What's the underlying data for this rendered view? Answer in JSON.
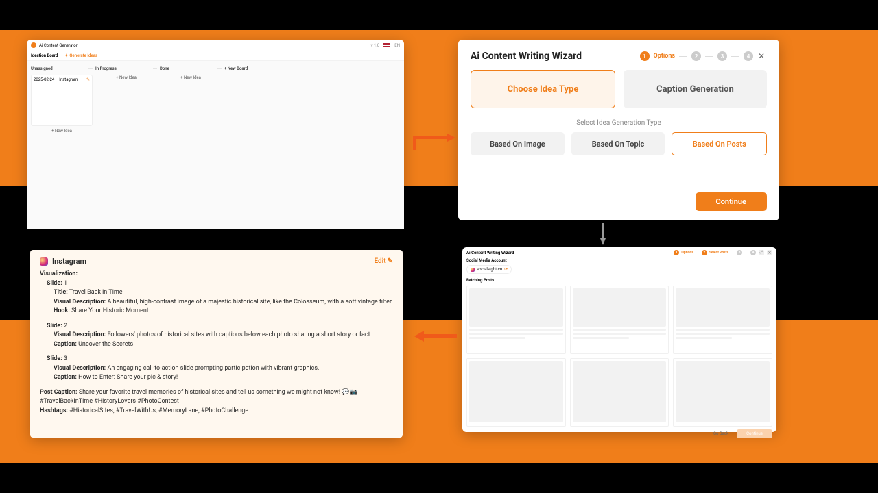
{
  "panelA": {
    "app_title": "Ai Content Generator",
    "version": "v 1.0",
    "lang": "EN",
    "board_title": "Ideation Board",
    "generate_label": "Generate Ideas",
    "columns": {
      "unassigned": {
        "title": "Unassigned",
        "card_title": "2025-02-24 – Instagram",
        "new_idea": "+ New Idea"
      },
      "in_progress": {
        "title": "In Progress",
        "new_idea": "+ New Idea"
      },
      "done": {
        "title": "Done",
        "new_idea": "+ New Idea"
      },
      "new_board": {
        "label": "+ New Board"
      }
    }
  },
  "panelB": {
    "title": "Ai Content Writing Wizard",
    "step_label": "Options",
    "tab_choose": "Choose Idea Type",
    "tab_caption": "Caption Generation",
    "select_label": "Select Idea Generation Type",
    "opt_image": "Based On Image",
    "opt_topic": "Based On Topic",
    "opt_posts": "Based On Posts",
    "continue": "Continue"
  },
  "panelC": {
    "title": "Ai Content Writing Wizard",
    "step_a": "Options",
    "step_b": "Select Posts",
    "sma_label": "Social Media Account",
    "account": "socialsight.co",
    "fetching": "Fetching Posts...",
    "go_back": "Go Back",
    "continue": "Continue"
  },
  "panelD": {
    "platform": "Instagram",
    "edit": "Edit",
    "viz_label": "Visualization:",
    "slides": [
      {
        "slide_label": "Slide:",
        "num": "1",
        "title_label": "Title:",
        "title": "Travel Back in Time",
        "vd_label": "Visual Description:",
        "vd": "A beautiful, high-contrast image of a majestic historical site, like the Colosseum, with a soft vintage filter.",
        "hook_label": "Hook:",
        "hook": "Share Your Historic Moment"
      },
      {
        "slide_label": "Slide:",
        "num": "2",
        "vd_label": "Visual Description:",
        "vd": "Followers' photos of historical sites with captions below each photo sharing a short story or fact.",
        "caption_label": "Caption:",
        "caption": "Uncover the Secrets"
      },
      {
        "slide_label": "Slide:",
        "num": "3",
        "vd_label": "Visual Description:",
        "vd": "An engaging call-to-action slide prompting participation with vibrant graphics.",
        "caption_label": "Caption:",
        "caption": "How to Enter: Share your pic & story!"
      }
    ],
    "post_caption_label": "Post Caption:",
    "post_caption": "Share your favorite travel memories of historical sites and tell us something we might not know! 💬📷 #TravelBackInTime #HistoryLovers #PhotoContest",
    "hashtags_label": "Hashtags:",
    "hashtags": "#HistoricalSites, #TravelWithUs, #MemoryLane, #PhotoChallenge"
  }
}
